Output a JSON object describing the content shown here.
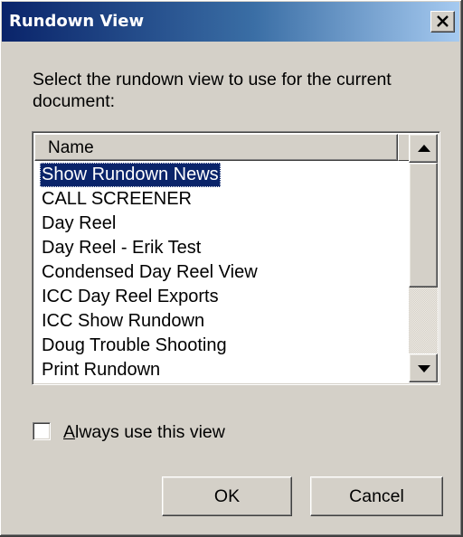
{
  "dialog": {
    "title": "Rundown View",
    "close_icon": "close-x-icon",
    "prompt": "Select the rundown view to use for the current document:"
  },
  "list": {
    "column_header": "Name",
    "selected_index": 0,
    "items": [
      "Show Rundown News",
      "CALL SCREENER",
      "Day Reel",
      "Day Reel - Erik Test",
      "Condensed Day Reel View",
      "ICC Day Reel Exports",
      "ICC Show Rundown",
      "Doug Trouble Shooting",
      "Print Rundown"
    ],
    "scroll_up_icon": "triangle-up-icon",
    "scroll_down_icon": "triangle-down-icon"
  },
  "options": {
    "always_use_label": "Always use this view",
    "always_use_checked": false
  },
  "buttons": {
    "ok_label": "OK",
    "cancel_label": "Cancel"
  },
  "colors": {
    "title_gradient_start": "#0a246a",
    "title_gradient_end": "#a6caf0",
    "face": "#d4d0c8",
    "selection": "#0a246a"
  }
}
